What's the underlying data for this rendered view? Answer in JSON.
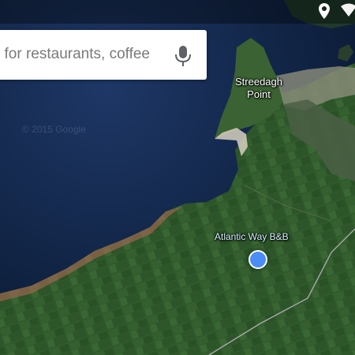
{
  "search": {
    "value": "Search for restaurants, coffee"
  },
  "map": {
    "place_labels": {
      "streedagh_line1": "Streedagh",
      "streedagh_line2": "Point",
      "bnb": "Atlantic Way B&B"
    },
    "watermark": "© 2015 Google",
    "colors": {
      "sea": "#0e1f3c",
      "land": "#2f5a2c",
      "beach": "#d7d0bf",
      "location_dot": "#4a8df6"
    }
  },
  "status_bar": {
    "icons": [
      "location-pin-icon",
      "wifi-icon"
    ]
  }
}
